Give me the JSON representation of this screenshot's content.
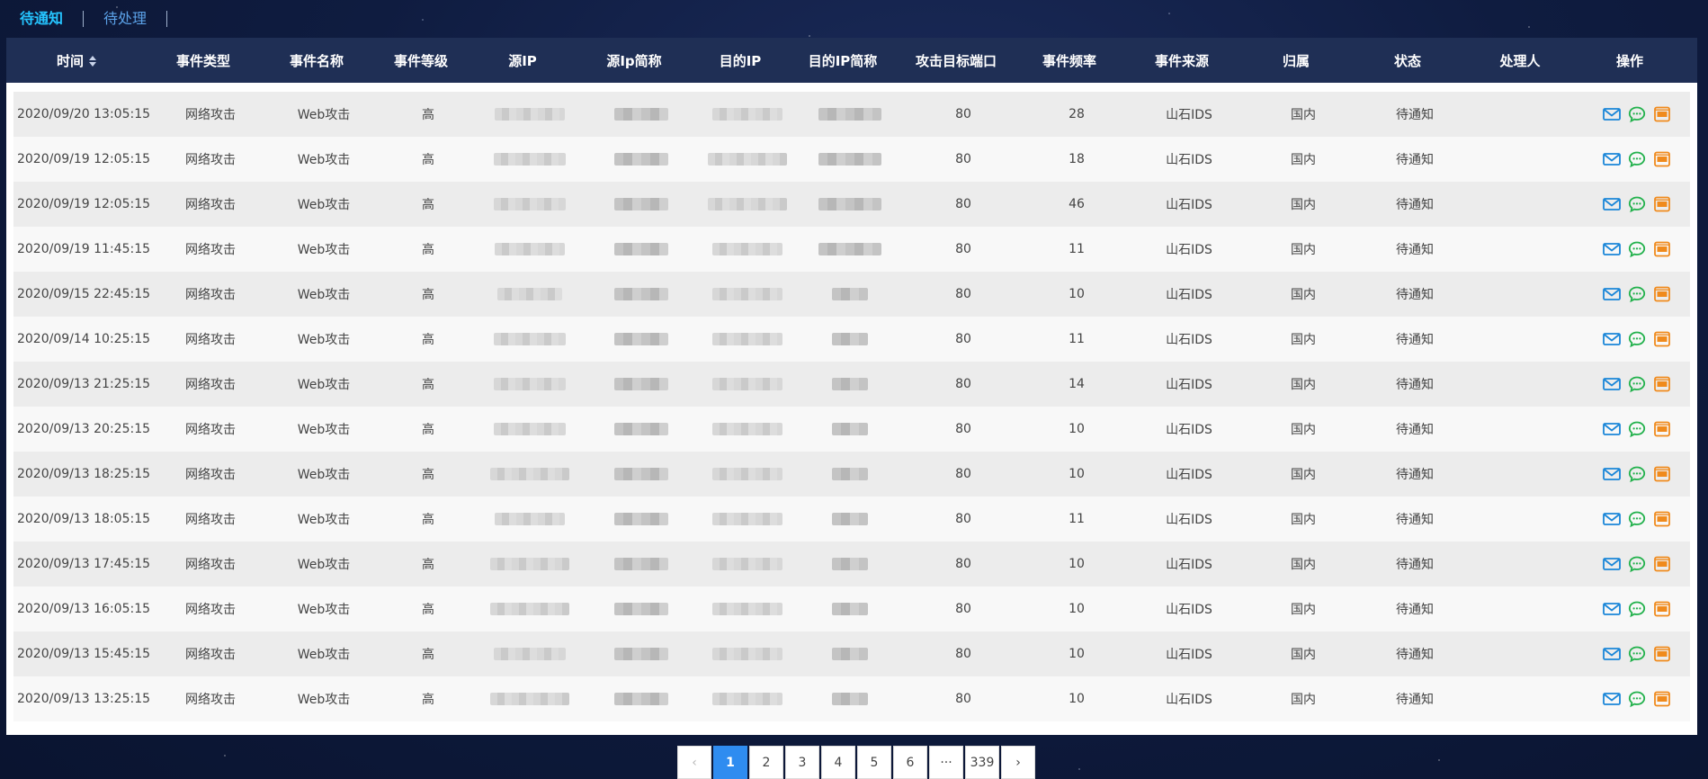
{
  "tabs": [
    {
      "label": "待通知",
      "active": true
    },
    {
      "label": "待处理",
      "active": false
    }
  ],
  "table": {
    "headers": [
      "时间",
      "事件类型",
      "事件名称",
      "事件等级",
      "源IP",
      "源Ip简称",
      "目的IP",
      "目的IP简称",
      "攻击目标端口",
      "事件频率",
      "事件来源",
      "归属",
      "状态",
      "处理人",
      "操作"
    ],
    "rows": [
      {
        "time": "2020/09/20 13:05:15",
        "type": "网络攻击",
        "name": "Web攻击",
        "level": "高",
        "port": "80",
        "freq": "28",
        "source": "山石IDS",
        "home": "国内",
        "status": "待通知",
        "handler": ""
      },
      {
        "time": "2020/09/19 12:05:15",
        "type": "网络攻击",
        "name": "Web攻击",
        "level": "高",
        "port": "80",
        "freq": "18",
        "source": "山石IDS",
        "home": "国内",
        "status": "待通知",
        "handler": ""
      },
      {
        "time": "2020/09/19 12:05:15",
        "type": "网络攻击",
        "name": "Web攻击",
        "level": "高",
        "port": "80",
        "freq": "46",
        "source": "山石IDS",
        "home": "国内",
        "status": "待通知",
        "handler": ""
      },
      {
        "time": "2020/09/19 11:45:15",
        "type": "网络攻击",
        "name": "Web攻击",
        "level": "高",
        "port": "80",
        "freq": "11",
        "source": "山石IDS",
        "home": "国内",
        "status": "待通知",
        "handler": ""
      },
      {
        "time": "2020/09/15 22:45:15",
        "type": "网络攻击",
        "name": "Web攻击",
        "level": "高",
        "port": "80",
        "freq": "10",
        "source": "山石IDS",
        "home": "国内",
        "status": "待通知",
        "handler": ""
      },
      {
        "time": "2020/09/14 10:25:15",
        "type": "网络攻击",
        "name": "Web攻击",
        "level": "高",
        "port": "80",
        "freq": "11",
        "source": "山石IDS",
        "home": "国内",
        "status": "待通知",
        "handler": ""
      },
      {
        "time": "2020/09/13 21:25:15",
        "type": "网络攻击",
        "name": "Web攻击",
        "level": "高",
        "port": "80",
        "freq": "14",
        "source": "山石IDS",
        "home": "国内",
        "status": "待通知",
        "handler": ""
      },
      {
        "time": "2020/09/13 20:25:15",
        "type": "网络攻击",
        "name": "Web攻击",
        "level": "高",
        "port": "80",
        "freq": "10",
        "source": "山石IDS",
        "home": "国内",
        "status": "待通知",
        "handler": ""
      },
      {
        "time": "2020/09/13 18:25:15",
        "type": "网络攻击",
        "name": "Web攻击",
        "level": "高",
        "port": "80",
        "freq": "10",
        "source": "山石IDS",
        "home": "国内",
        "status": "待通知",
        "handler": ""
      },
      {
        "time": "2020/09/13 18:05:15",
        "type": "网络攻击",
        "name": "Web攻击",
        "level": "高",
        "port": "80",
        "freq": "11",
        "source": "山石IDS",
        "home": "国内",
        "status": "待通知",
        "handler": ""
      },
      {
        "time": "2020/09/13 17:45:15",
        "type": "网络攻击",
        "name": "Web攻击",
        "level": "高",
        "port": "80",
        "freq": "10",
        "source": "山石IDS",
        "home": "国内",
        "status": "待通知",
        "handler": ""
      },
      {
        "time": "2020/09/13 16:05:15",
        "type": "网络攻击",
        "name": "Web攻击",
        "level": "高",
        "port": "80",
        "freq": "10",
        "source": "山石IDS",
        "home": "国内",
        "status": "待通知",
        "handler": ""
      },
      {
        "time": "2020/09/13 15:45:15",
        "type": "网络攻击",
        "name": "Web攻击",
        "level": "高",
        "port": "80",
        "freq": "10",
        "source": "山石IDS",
        "home": "国内",
        "status": "待通知",
        "handler": ""
      },
      {
        "time": "2020/09/13 13:25:15",
        "type": "网络攻击",
        "name": "Web攻击",
        "level": "高",
        "port": "80",
        "freq": "10",
        "source": "山石IDS",
        "home": "国内",
        "status": "待通知",
        "handler": ""
      }
    ],
    "row_actions": [
      "mail-icon",
      "chat-bubble-icon",
      "app-icon"
    ]
  },
  "pagination": {
    "prev": "‹",
    "pages": [
      "1",
      "2",
      "3",
      "4",
      "5",
      "6",
      "···",
      "339"
    ],
    "current": "1",
    "next": "›"
  },
  "colors": {
    "header_bg": "#1f2f55",
    "tab_active": "#25c4ff",
    "page_active": "#2f8cf0",
    "mail_icon": "#1a86d8",
    "chat_icon": "#22b14c",
    "app_icon": "#f08a1c"
  }
}
